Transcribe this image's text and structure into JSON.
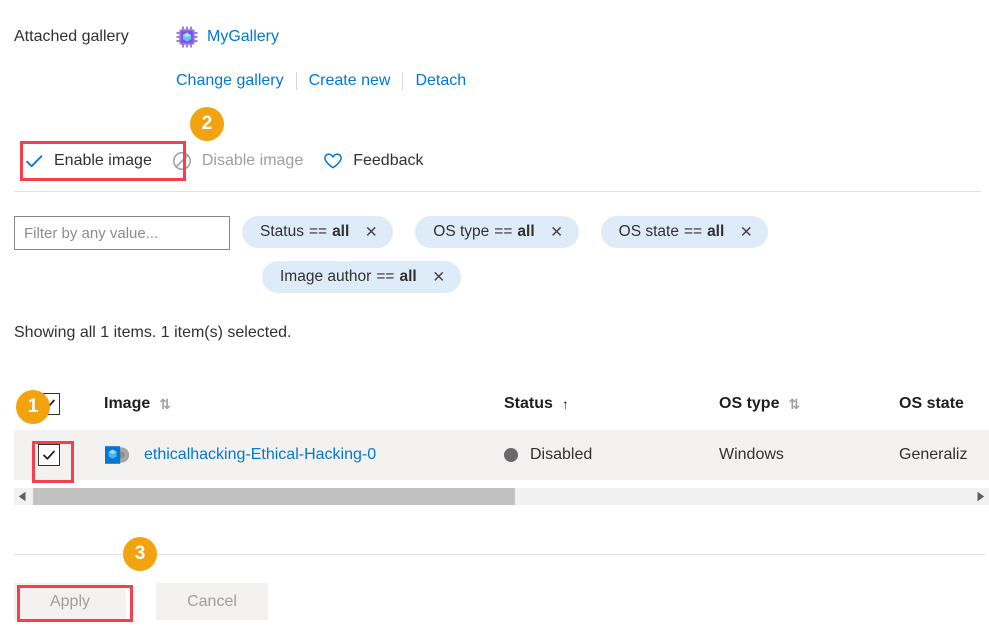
{
  "gallery": {
    "label": "Attached gallery",
    "name": "MyGallery",
    "icon": "gallery-chip-icon",
    "links": [
      {
        "label": "Change gallery"
      },
      {
        "label": "Create new"
      },
      {
        "label": "Detach"
      }
    ]
  },
  "commandbar": {
    "items": [
      {
        "label": "Enable image",
        "icon": "checkmark-icon",
        "disabled": false
      },
      {
        "label": "Disable image",
        "icon": "block-icon",
        "disabled": true
      },
      {
        "label": "Feedback",
        "icon": "heart-icon",
        "disabled": false
      }
    ]
  },
  "filter": {
    "placeholder": "Filter by any value...",
    "value": "",
    "pills": [
      {
        "key": "Status",
        "op": "==",
        "value": "all"
      },
      {
        "key": "OS type",
        "op": "==",
        "value": "all"
      },
      {
        "key": "OS state",
        "op": "==",
        "value": "all"
      },
      {
        "key": "Image author",
        "op": "==",
        "value": "all"
      }
    ]
  },
  "status_line": "Showing all 1 items.  1 item(s) selected.",
  "table": {
    "columns": [
      {
        "label": "Image",
        "sort": "both"
      },
      {
        "label": "Status",
        "sort": "asc"
      },
      {
        "label": "OS type",
        "sort": "both"
      },
      {
        "label": "OS state",
        "sort": "none"
      }
    ],
    "select_all_checked": true,
    "rows": [
      {
        "checked": true,
        "image": "ethicalhacking-Ethical-Hacking-0",
        "image_icon": "vm-image-icon",
        "status": "Disabled",
        "status_dot_color": "#69696b",
        "os_type": "Windows",
        "os_state": "Generaliz"
      }
    ]
  },
  "scrollbar": {
    "left_arrow": "◀",
    "right_arrow": "▶"
  },
  "footer": {
    "apply_label": "Apply",
    "cancel_label": "Cancel"
  },
  "annotations": {
    "badges": [
      {
        "number": "1"
      },
      {
        "number": "2"
      },
      {
        "number": "3"
      }
    ]
  },
  "glyphs": {
    "sort_both": "⇅",
    "sort_asc": "↑",
    "pill_close": "✕"
  },
  "colors": {
    "link": "#0078d4",
    "pill_bg": "#deecf9",
    "badge": "#f2a30f",
    "highlight": "#f4404a",
    "row_bg": "#f3f2f1"
  }
}
